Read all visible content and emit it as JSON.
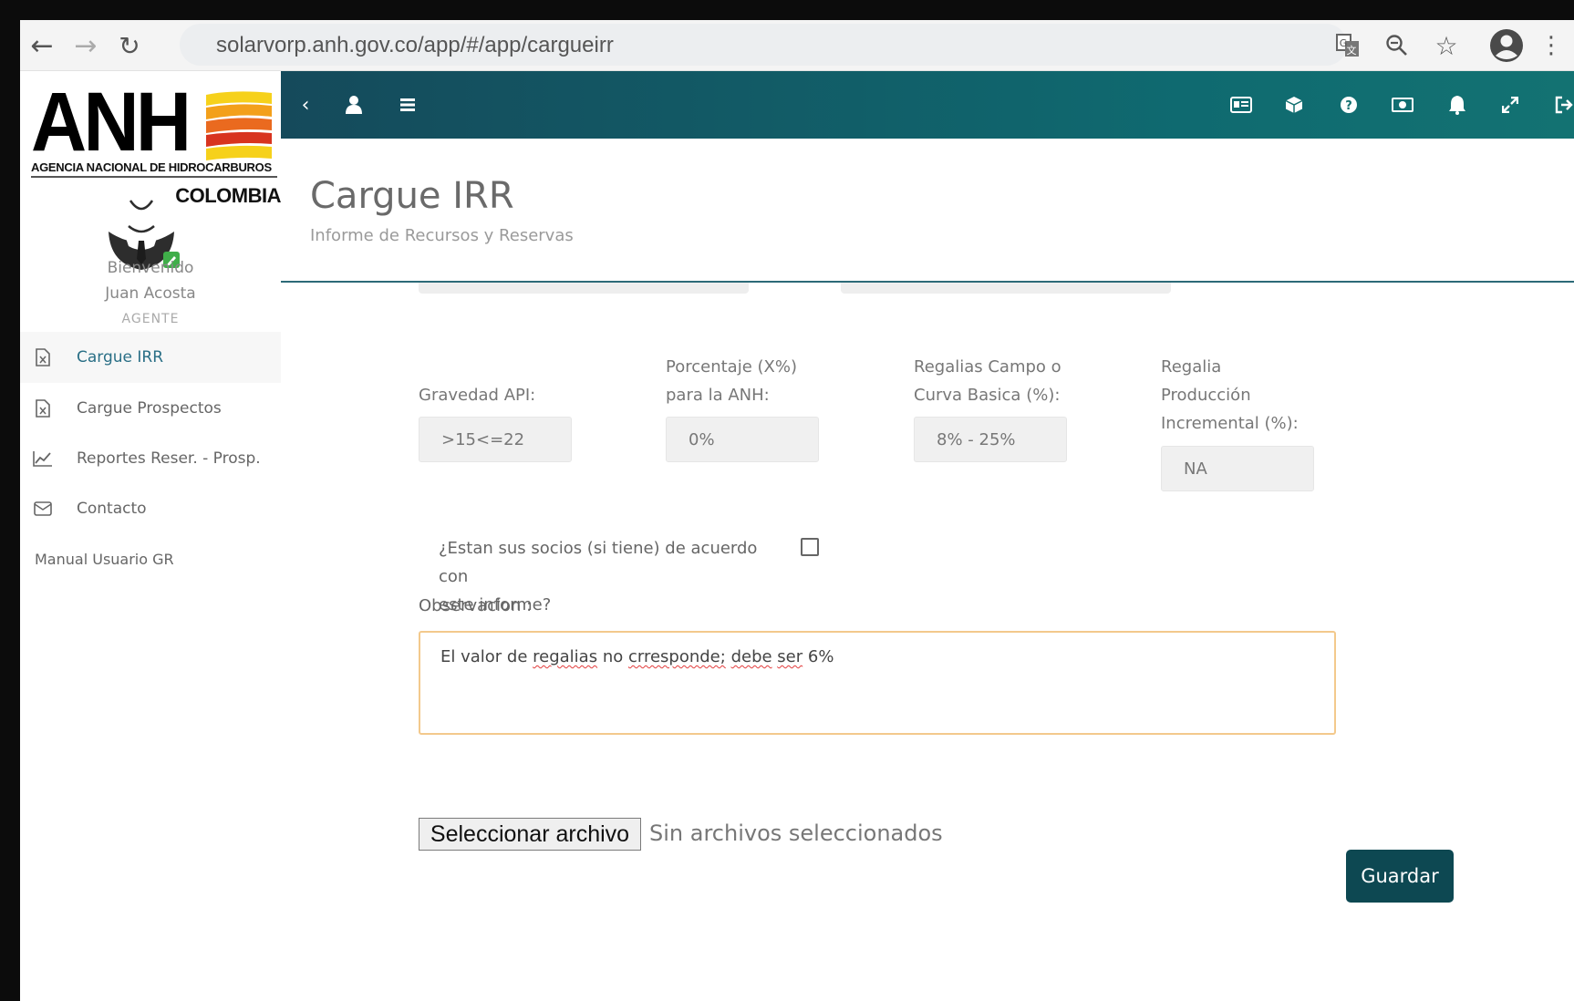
{
  "browser": {
    "url": "solarvorp.anh.gov.co/app/#/app/cargueirr",
    "nav_icons": [
      "back-arrow-icon",
      "forward-arrow-icon",
      "reload-icon"
    ],
    "toolbar_icons": [
      "translate-icon",
      "zoom-icon",
      "star-icon",
      "account-icon",
      "kebab-menu-icon"
    ]
  },
  "logo": {
    "letters": "ANH",
    "subtitle": "AGENCIA NACIONAL DE HIDROCARBUROS",
    "country": "COLOMBIA",
    "colors": [
      "#f7d21c",
      "#f39a1a",
      "#e8561e",
      "#c81e1e",
      "#f7d21c"
    ]
  },
  "user": {
    "greeting": "Bienvenido",
    "name": "Juan Acosta",
    "role": "AGENTE"
  },
  "sidebar": {
    "items": [
      {
        "label": "Cargue IRR",
        "icon": "file-excel-icon",
        "active": true
      },
      {
        "label": "Cargue Prospectos",
        "icon": "file-excel-icon",
        "active": false
      },
      {
        "label": "Reportes Reser. - Prosp.",
        "icon": "line-chart-icon",
        "active": false
      },
      {
        "label": "Contacto",
        "icon": "envelope-icon",
        "active": false
      }
    ],
    "manual": "Manual Usuario GR"
  },
  "topbar": {
    "gradient": [
      "#154a5b",
      "#137272"
    ],
    "left_icons": [
      "chevron-left-icon",
      "user-icon",
      "list-icon"
    ],
    "right_icons": [
      "id-card-icon",
      "cube-icon",
      "help-icon",
      "money-icon",
      "bell-icon",
      "expand-icon",
      "sign-out-icon"
    ]
  },
  "page": {
    "title": "Cargue IRR",
    "subtitle": "Informe de Recursos y Reservas"
  },
  "form": {
    "fields": [
      {
        "label_lines": [
          "Gravedad API:"
        ],
        "value": ">15<=22"
      },
      {
        "label_lines": [
          "Porcentaje (X%)",
          "para la ANH:"
        ],
        "value": "0%"
      },
      {
        "label_lines": [
          "Regalias Campo o",
          "Curva Basica (%):"
        ],
        "value": "8% - 25%"
      },
      {
        "label_lines": [
          "Regalia",
          "Producción",
          "Incremental (%):"
        ],
        "value": "NA"
      }
    ],
    "partners_question_line1": "¿Estan sus socios (si tiene) de acuerdo con",
    "partners_question_line2": "este informe?",
    "partners_checked": false,
    "observation_label": "Observacion :",
    "observation_text": {
      "w1": "El valor de ",
      "w2": "regalias",
      "w3": " no ",
      "w4": "crresponde;",
      "w5": " ",
      "w6": "debe",
      "w7": " ",
      "w8": "ser",
      "w9": " 6%"
    },
    "file_button": "Seleccionar archivo",
    "file_status": "Sin archivos seleccionados",
    "save_button": "Guardar",
    "accent_color": "#0d4852",
    "observation_border": "#f3c98c"
  }
}
